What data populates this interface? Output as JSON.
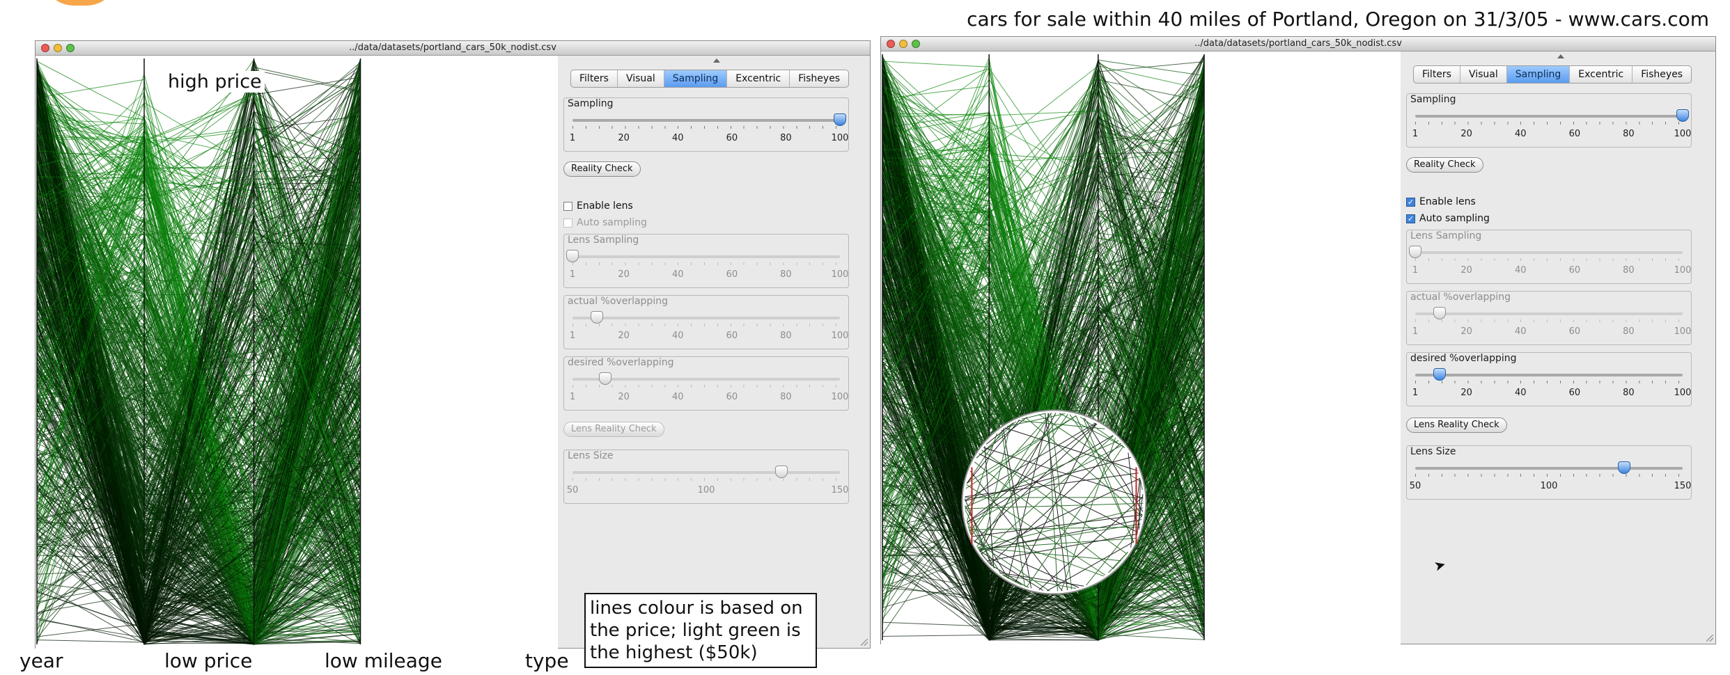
{
  "header": {
    "caption": "cars for sale within 40 miles of Portland, Oregon on 31/3/05 - www.cars.com"
  },
  "axes": [
    "year",
    "low price",
    "low mileage",
    "type"
  ],
  "plot_label": "high price",
  "note": "lines colour is based on the price; light green is the highest ($50k)",
  "colors": {
    "low_price_line": "#0b1a0b",
    "high_price_line": "#1f8a1f",
    "active_tab": "#5b9cf0",
    "lens_edge": "#cc2222"
  },
  "windows": [
    {
      "title": "../data/datasets/portland_cars_50k_nodist.csv",
      "tabs": [
        "Filters",
        "Visual",
        "Sampling",
        "Excentric",
        "Fisheyes"
      ],
      "active_tab": "Sampling",
      "sampling": {
        "label": "Sampling",
        "ticks": [
          "1",
          "20",
          "40",
          "60",
          "80",
          "100"
        ],
        "value": 100
      },
      "reality_check": "Reality Check",
      "enable_lens": {
        "label": "Enable lens",
        "checked": false
      },
      "auto_sampling": {
        "label": "Auto sampling",
        "checked": false
      },
      "lens_sampling": {
        "label": "Lens Sampling",
        "ticks": [
          "1",
          "20",
          "40",
          "60",
          "80",
          "100"
        ],
        "value": 1
      },
      "actual_overlap": {
        "label": "actual %overlapping",
        "ticks": [
          "1",
          "20",
          "40",
          "60",
          "80",
          "100"
        ],
        "value": 10
      },
      "desired_overlap": {
        "label": "desired %overlapping",
        "ticks": [
          "1",
          "20",
          "40",
          "60",
          "80",
          "100"
        ],
        "value": 13
      },
      "lens_reality_check": "Lens Reality Check",
      "lens_size": {
        "label": "Lens Size",
        "ticks": [
          "50",
          "100",
          "150"
        ],
        "value": 128
      },
      "lens_enabled": false
    },
    {
      "title": "../data/datasets/portland_cars_50k_nodist.csv",
      "tabs": [
        "Filters",
        "Visual",
        "Sampling",
        "Excentric",
        "Fisheyes"
      ],
      "active_tab": "Sampling",
      "sampling": {
        "label": "Sampling",
        "ticks": [
          "1",
          "20",
          "40",
          "60",
          "80",
          "100"
        ],
        "value": 100
      },
      "reality_check": "Reality Check",
      "enable_lens": {
        "label": "Enable lens",
        "checked": true
      },
      "auto_sampling": {
        "label": "Auto sampling",
        "checked": true
      },
      "lens_sampling": {
        "label": "Lens Sampling",
        "ticks": [
          "1",
          "20",
          "40",
          "60",
          "80",
          "100"
        ],
        "value": 1
      },
      "actual_overlap": {
        "label": "actual %overlapping",
        "ticks": [
          "1",
          "20",
          "40",
          "60",
          "80",
          "100"
        ],
        "value": 10
      },
      "desired_overlap": {
        "label": "desired %overlapping",
        "ticks": [
          "1",
          "20",
          "40",
          "60",
          "80",
          "100"
        ],
        "value": 10
      },
      "lens_reality_check": "Lens Reality Check",
      "lens_size": {
        "label": "Lens Size",
        "ticks": [
          "50",
          "100",
          "150"
        ],
        "value": 128
      },
      "lens_enabled": true
    }
  ]
}
